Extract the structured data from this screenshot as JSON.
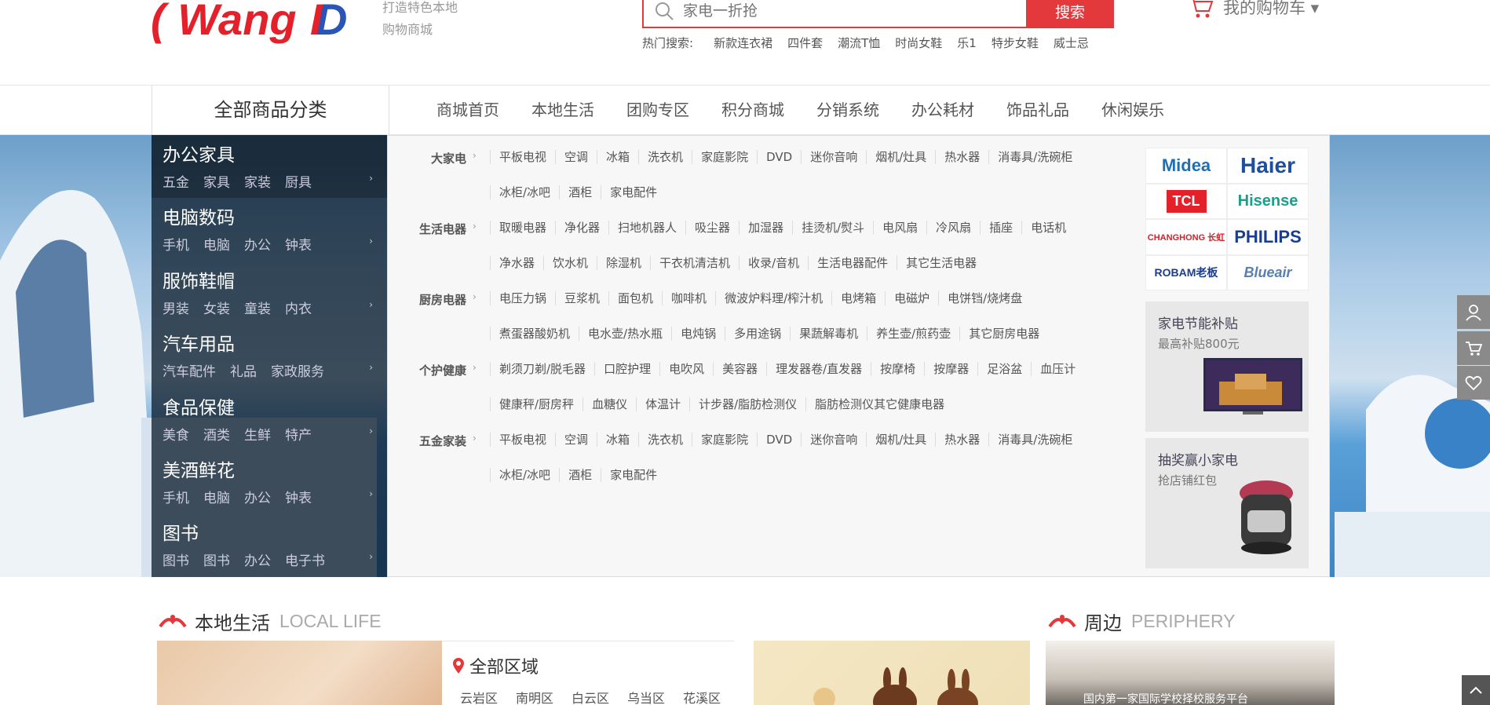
{
  "header": {
    "logo_text": "WangID",
    "slogan": [
      "打造特色本地",
      "购物商城"
    ],
    "search": {
      "placeholder": "家电一折抢",
      "button_label": "搜索"
    },
    "cart_label": "我的购物车 ▾",
    "hot": {
      "label": "热门搜索:",
      "terms": [
        "新款连衣裙",
        "四件套",
        "潮流T恤",
        "时尚女鞋",
        "乐1",
        "特步女鞋",
        "威士忌"
      ]
    }
  },
  "nav": {
    "all_categories": "全部商品分类",
    "links": [
      "商城首页",
      "本地生活",
      "团购专区",
      "积分商城",
      "分销系统",
      "办公耗材",
      "饰品礼品",
      "休闲娱乐"
    ]
  },
  "sidebar": {
    "items": [
      {
        "title": "办公家具",
        "subs": [
          "五金",
          "家具",
          "家装",
          "厨具"
        ]
      },
      {
        "title": "电脑数码",
        "subs": [
          "手机",
          "电脑",
          "办公",
          "钟表"
        ]
      },
      {
        "title": "服饰鞋帽",
        "subs": [
          "男装",
          "女装",
          "童装",
          "内衣"
        ]
      },
      {
        "title": "汽车用品",
        "subs": [
          "汽车配件",
          "礼品",
          "家政服务"
        ]
      },
      {
        "title": "食品保健",
        "subs": [
          "美食",
          "酒类",
          "生鲜",
          "特产"
        ]
      },
      {
        "title": "美酒鲜花",
        "subs": [
          "手机",
          "电脑",
          "办公",
          "钟表"
        ]
      },
      {
        "title": "图书",
        "subs": [
          "图书",
          "图书",
          "办公",
          "电子书"
        ]
      }
    ],
    "arrow": "›"
  },
  "mega": {
    "rows": [
      {
        "title": "大家电",
        "lines": [
          [
            "平板电视",
            "空调",
            "冰箱",
            "洗衣机",
            "家庭影院",
            "DVD",
            "迷你音响",
            "烟机/灶具",
            "热水器",
            "消毒具/洗碗柜"
          ],
          [
            "冰柜/冰吧",
            "酒柜",
            "家电配件"
          ]
        ]
      },
      {
        "title": "生活电器",
        "lines": [
          [
            "取暖电器",
            "净化器",
            "扫地机器人",
            "吸尘器",
            "加湿器",
            "挂烫机/熨斗",
            "电风扇",
            "冷风扇",
            "插座",
            "电话机"
          ],
          [
            "净水器",
            "饮水机",
            "除湿机",
            "干衣机清洁机",
            "收录/音机",
            "生活电器配件",
            "其它生活电器"
          ]
        ]
      },
      {
        "title": "厨房电器",
        "lines": [
          [
            "电压力锅",
            "豆浆机",
            "面包机",
            "咖啡机",
            "微波炉料理/榨汁机",
            "电烤箱",
            "电磁炉",
            "电饼铛/烧烤盘"
          ],
          [
            "煮蛋器酸奶机",
            "电水壶/热水瓶",
            "电炖锅",
            "多用途锅",
            "果蔬解毒机",
            "养生壶/煎药壶",
            "其它厨房电器"
          ]
        ]
      },
      {
        "title": "个护健康",
        "lines": [
          [
            "剃须刀剃/脱毛器",
            "口腔护理",
            "电吹风",
            "美容器",
            "理发器卷/直发器",
            "按摩椅",
            "按摩器",
            "足浴盆",
            "血压计"
          ],
          [
            "健康秤/厨房秤",
            "血糖仪",
            "体温计",
            "计步器/脂肪检测仪",
            "脂肪检测仪其它健康电器"
          ]
        ]
      },
      {
        "title": "五金家装",
        "lines": [
          [
            "平板电视",
            "空调",
            "冰箱",
            "洗衣机",
            "家庭影院",
            "DVD",
            "迷你音响",
            "烟机/灶具",
            "热水器",
            "消毒具/洗碗柜"
          ],
          [
            "冰柜/冰吧",
            "酒柜",
            "家电配件"
          ]
        ]
      }
    ],
    "arrow": "›"
  },
  "brands": [
    {
      "name": "Midea",
      "color": "#1f6fb5"
    },
    {
      "name": "Haier",
      "color": "#1b4fa0"
    },
    {
      "name": "TCL",
      "color": "#e4202a"
    },
    {
      "name": "Hisense",
      "color": "#19a08d"
    },
    {
      "name": "CHANGHONG 长虹",
      "color": "#d3202a"
    },
    {
      "name": "PHILIPS",
      "color": "#1a3d8f"
    },
    {
      "name": "ROBAM老板",
      "color": "#1a3d8f"
    },
    {
      "name": "Blueair",
      "color": "#5a7fb0"
    }
  ],
  "promos": [
    {
      "title": "家电节能补贴",
      "sub": "最高补贴800元"
    },
    {
      "title": "抽奖赢小家电",
      "sub": "抢店铺红包"
    }
  ],
  "sections": {
    "local": {
      "cn": "本地生活",
      "en": "LOCAL LIFE"
    },
    "periphery": {
      "cn": "周边",
      "en": "PERIPHERY"
    }
  },
  "region": {
    "title": "全部区域",
    "list": [
      "云岩区",
      "南明区",
      "白云区",
      "乌当区",
      "花溪区"
    ]
  },
  "periphery_banner": "国内第一家国际学校择校服务平台",
  "colors": {
    "accent": "#e4393c"
  }
}
